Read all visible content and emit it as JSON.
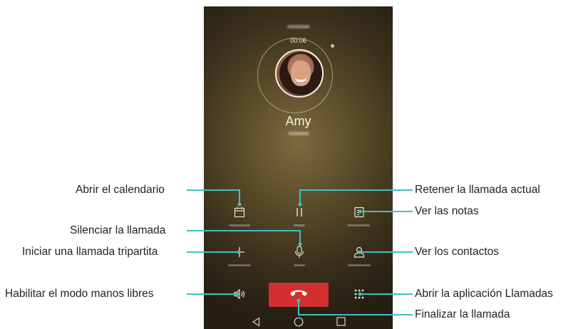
{
  "call": {
    "timer": "00:06",
    "contact_name": "Amy"
  },
  "buttons": {
    "calendar": {
      "icon": "calendar-icon"
    },
    "hold": {
      "icon": "pause-icon"
    },
    "notepad": {
      "icon": "notepad-icon"
    },
    "add_call": {
      "icon": "plus-icon"
    },
    "mute": {
      "icon": "microphone-icon"
    },
    "contacts": {
      "icon": "contact-icon"
    },
    "speaker": {
      "icon": "speaker-icon"
    },
    "end_call": {
      "icon": "phone-hangup-icon",
      "color": "#d32f2f"
    },
    "dialpad": {
      "icon": "dialpad-icon"
    }
  },
  "nav": {
    "back": "back-icon",
    "home": "home-icon",
    "recents": "recents-icon"
  },
  "callouts": {
    "calendar": "Abrir el calendario",
    "hold": "Retener la llamada actual",
    "notes": "Ver las notas",
    "mute": "Silenciar la llamada",
    "add_call": "Iniciar una llamada tripartita",
    "contacts": "Ver los contactos",
    "speaker": "Habilitar el modo manos libres",
    "dialpad": "Abrir la aplicación Llamadas",
    "end_call": "Finalizar la llamada"
  },
  "colors": {
    "leader": "#3fc1c0",
    "end_call": "#d32f2f",
    "label_text": "#231f20"
  }
}
